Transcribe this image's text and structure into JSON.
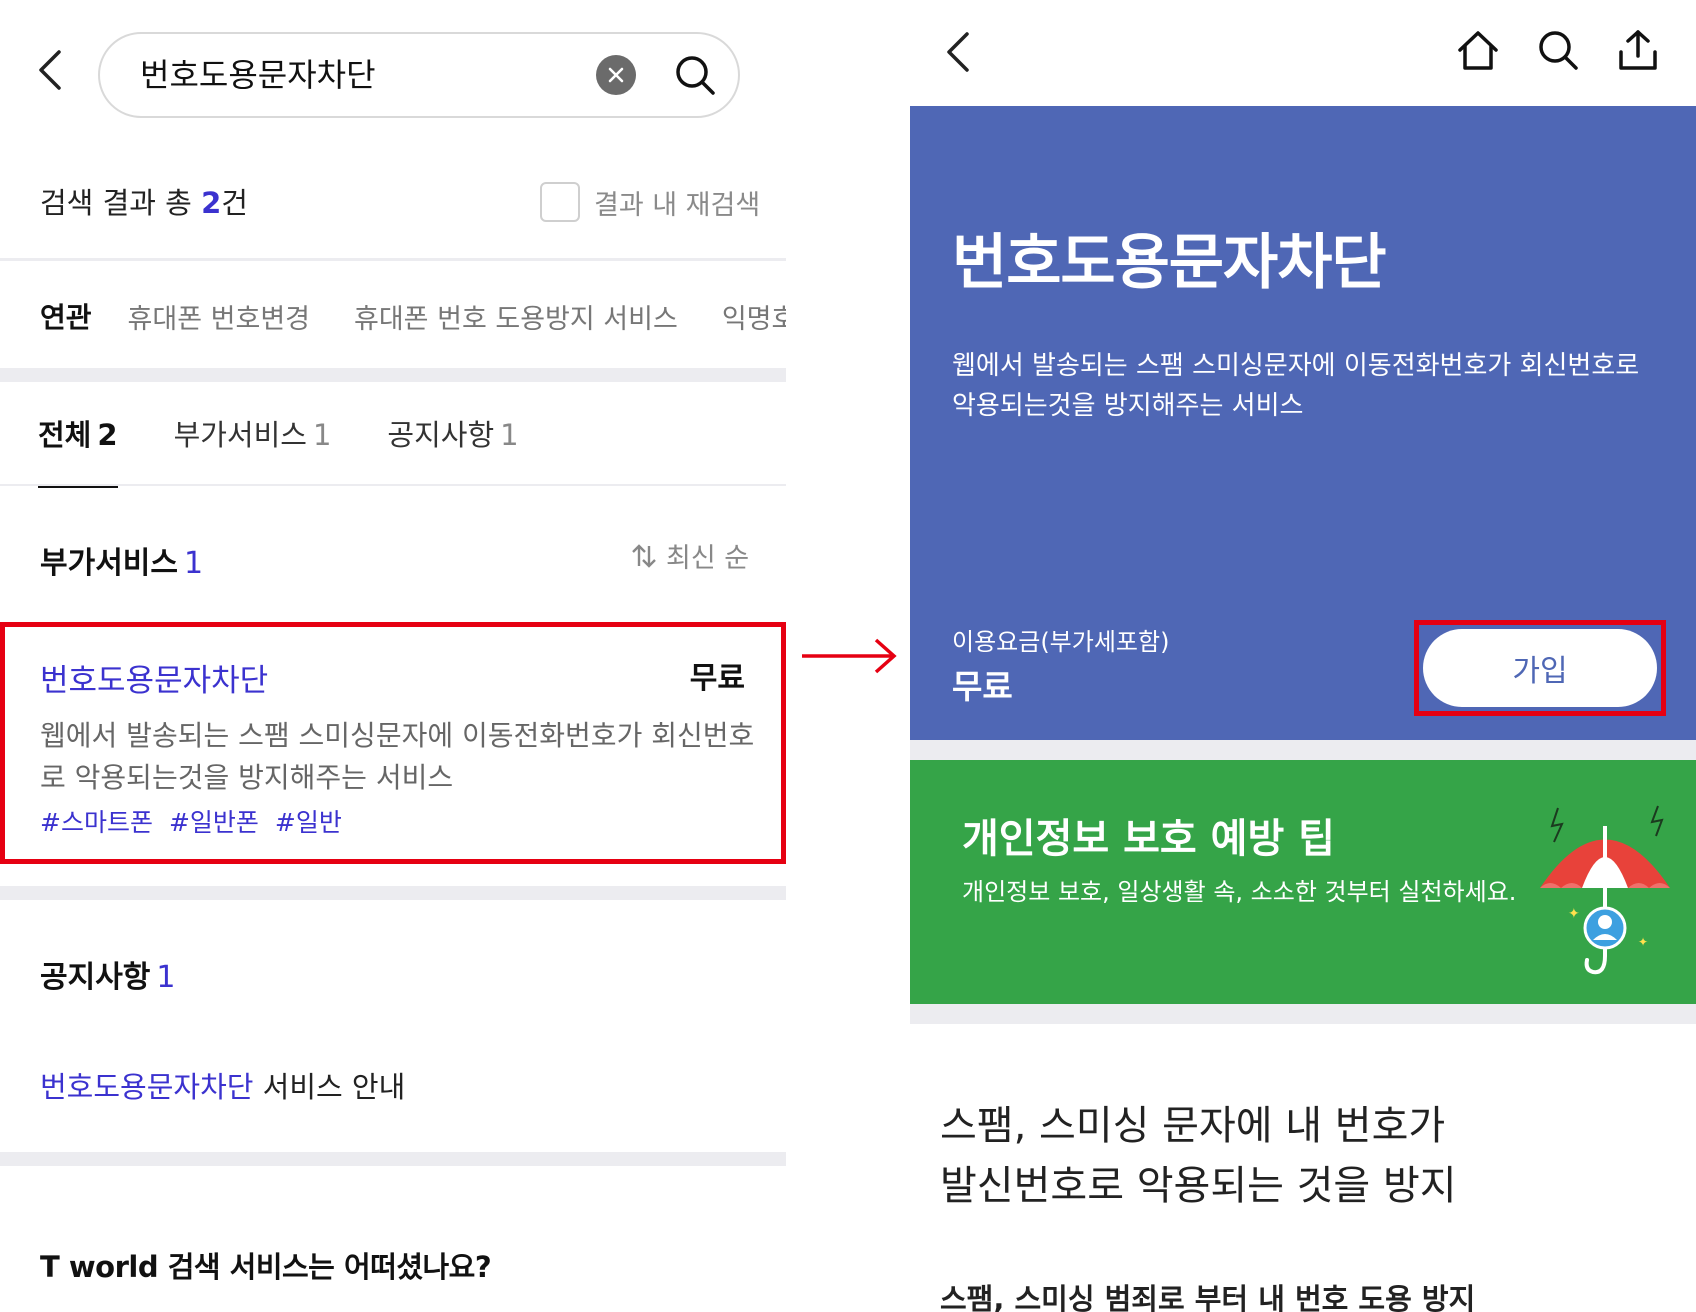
{
  "left": {
    "search": {
      "query": "번호도용문자차단"
    },
    "result_summary": {
      "prefix": "검색 결과 총 ",
      "count": "2",
      "suffix": "건"
    },
    "research_label": "결과 내 재검색",
    "related": {
      "title": "연관",
      "items": [
        "휴대폰 번호변경",
        "휴대폰 번호 도용방지 서비스",
        "익명호수신"
      ]
    },
    "tabs": [
      {
        "label": "전체",
        "count": "2"
      },
      {
        "label": "부가서비스",
        "count": "1"
      },
      {
        "label": "공지사항",
        "count": "1"
      }
    ],
    "addon_section": {
      "title": "부가서비스",
      "count": "1",
      "sort_label": "최신 순"
    },
    "service": {
      "name": "번호도용문자차단",
      "price": "무료",
      "description": "웹에서 발송되는 스팸 스미싱문자에 이동전화번호가 회신번호로 악용되는것을 방지해주는 서비스",
      "tags": [
        "#스마트폰",
        "#일반폰",
        "#일반"
      ]
    },
    "notice_section": {
      "title": "공지사항",
      "count": "1"
    },
    "notice_item": {
      "highlight": "번호도용문자차단",
      "rest": " 서비스 안내"
    },
    "feedback_title": "T world 검색 서비스는 어떠셨나요?"
  },
  "right": {
    "hero": {
      "title": "번호도용문자차단",
      "description": "웹에서 발송되는 스팸 스미싱문자에 이동전화번호가 회신번호로 악용되는것을 방지해주는 서비스",
      "fee_label": "이용요금(부가세포함)",
      "fee_value": "무료",
      "join_label": "가입"
    },
    "tip": {
      "title": "개인정보 보호 예방 팁",
      "description": "개인정보 보호, 일상생활 속, 소소한 것부터 실천하세요."
    },
    "main_copy": {
      "line1": "스팸, 스미싱 문자에 내 번호가",
      "line2": "발신번호로 악용되는 것을 방지"
    },
    "sub_copy": "스팸, 스미싱 범죄로 부터 내 번호 도용 방지"
  },
  "colors": {
    "accent_blue": "#3b32cf",
    "hero_blue": "#4f67b5",
    "tip_green": "#35a448",
    "highlight_red": "#e60012"
  },
  "icons": [
    "back-arrow-icon",
    "clear-icon",
    "search-icon",
    "sort-icon",
    "home-icon",
    "share-icon",
    "umbrella-illustration"
  ]
}
